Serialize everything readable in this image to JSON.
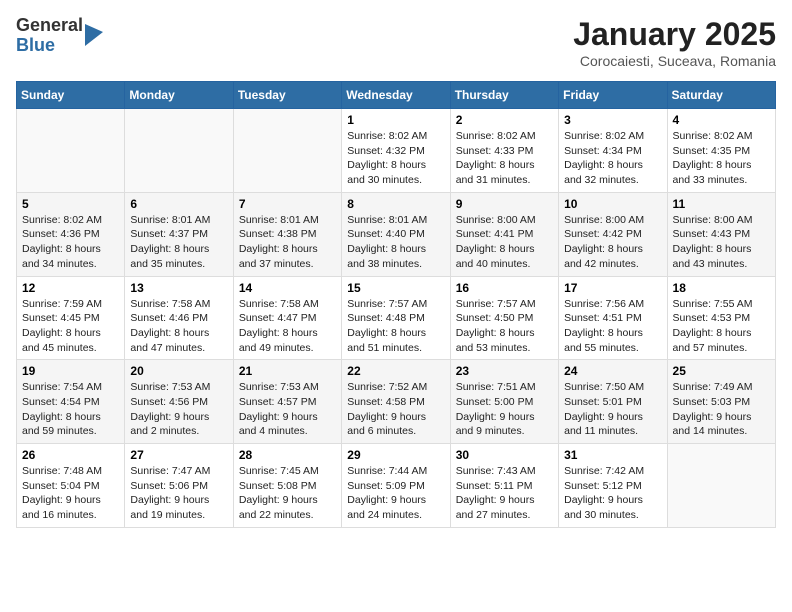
{
  "logo": {
    "line1": "General",
    "line2": "Blue"
  },
  "title": "January 2025",
  "subtitle": "Corocaiesti, Suceava, Romania",
  "days_of_week": [
    "Sunday",
    "Monday",
    "Tuesday",
    "Wednesday",
    "Thursday",
    "Friday",
    "Saturday"
  ],
  "weeks": [
    [
      {
        "day": "",
        "info": ""
      },
      {
        "day": "",
        "info": ""
      },
      {
        "day": "",
        "info": ""
      },
      {
        "day": "1",
        "info": "Sunrise: 8:02 AM\nSunset: 4:32 PM\nDaylight: 8 hours\nand 30 minutes."
      },
      {
        "day": "2",
        "info": "Sunrise: 8:02 AM\nSunset: 4:33 PM\nDaylight: 8 hours\nand 31 minutes."
      },
      {
        "day": "3",
        "info": "Sunrise: 8:02 AM\nSunset: 4:34 PM\nDaylight: 8 hours\nand 32 minutes."
      },
      {
        "day": "4",
        "info": "Sunrise: 8:02 AM\nSunset: 4:35 PM\nDaylight: 8 hours\nand 33 minutes."
      }
    ],
    [
      {
        "day": "5",
        "info": "Sunrise: 8:02 AM\nSunset: 4:36 PM\nDaylight: 8 hours\nand 34 minutes."
      },
      {
        "day": "6",
        "info": "Sunrise: 8:01 AM\nSunset: 4:37 PM\nDaylight: 8 hours\nand 35 minutes."
      },
      {
        "day": "7",
        "info": "Sunrise: 8:01 AM\nSunset: 4:38 PM\nDaylight: 8 hours\nand 37 minutes."
      },
      {
        "day": "8",
        "info": "Sunrise: 8:01 AM\nSunset: 4:40 PM\nDaylight: 8 hours\nand 38 minutes."
      },
      {
        "day": "9",
        "info": "Sunrise: 8:00 AM\nSunset: 4:41 PM\nDaylight: 8 hours\nand 40 minutes."
      },
      {
        "day": "10",
        "info": "Sunrise: 8:00 AM\nSunset: 4:42 PM\nDaylight: 8 hours\nand 42 minutes."
      },
      {
        "day": "11",
        "info": "Sunrise: 8:00 AM\nSunset: 4:43 PM\nDaylight: 8 hours\nand 43 minutes."
      }
    ],
    [
      {
        "day": "12",
        "info": "Sunrise: 7:59 AM\nSunset: 4:45 PM\nDaylight: 8 hours\nand 45 minutes."
      },
      {
        "day": "13",
        "info": "Sunrise: 7:58 AM\nSunset: 4:46 PM\nDaylight: 8 hours\nand 47 minutes."
      },
      {
        "day": "14",
        "info": "Sunrise: 7:58 AM\nSunset: 4:47 PM\nDaylight: 8 hours\nand 49 minutes."
      },
      {
        "day": "15",
        "info": "Sunrise: 7:57 AM\nSunset: 4:48 PM\nDaylight: 8 hours\nand 51 minutes."
      },
      {
        "day": "16",
        "info": "Sunrise: 7:57 AM\nSunset: 4:50 PM\nDaylight: 8 hours\nand 53 minutes."
      },
      {
        "day": "17",
        "info": "Sunrise: 7:56 AM\nSunset: 4:51 PM\nDaylight: 8 hours\nand 55 minutes."
      },
      {
        "day": "18",
        "info": "Sunrise: 7:55 AM\nSunset: 4:53 PM\nDaylight: 8 hours\nand 57 minutes."
      }
    ],
    [
      {
        "day": "19",
        "info": "Sunrise: 7:54 AM\nSunset: 4:54 PM\nDaylight: 8 hours\nand 59 minutes."
      },
      {
        "day": "20",
        "info": "Sunrise: 7:53 AM\nSunset: 4:56 PM\nDaylight: 9 hours\nand 2 minutes."
      },
      {
        "day": "21",
        "info": "Sunrise: 7:53 AM\nSunset: 4:57 PM\nDaylight: 9 hours\nand 4 minutes."
      },
      {
        "day": "22",
        "info": "Sunrise: 7:52 AM\nSunset: 4:58 PM\nDaylight: 9 hours\nand 6 minutes."
      },
      {
        "day": "23",
        "info": "Sunrise: 7:51 AM\nSunset: 5:00 PM\nDaylight: 9 hours\nand 9 minutes."
      },
      {
        "day": "24",
        "info": "Sunrise: 7:50 AM\nSunset: 5:01 PM\nDaylight: 9 hours\nand 11 minutes."
      },
      {
        "day": "25",
        "info": "Sunrise: 7:49 AM\nSunset: 5:03 PM\nDaylight: 9 hours\nand 14 minutes."
      }
    ],
    [
      {
        "day": "26",
        "info": "Sunrise: 7:48 AM\nSunset: 5:04 PM\nDaylight: 9 hours\nand 16 minutes."
      },
      {
        "day": "27",
        "info": "Sunrise: 7:47 AM\nSunset: 5:06 PM\nDaylight: 9 hours\nand 19 minutes."
      },
      {
        "day": "28",
        "info": "Sunrise: 7:45 AM\nSunset: 5:08 PM\nDaylight: 9 hours\nand 22 minutes."
      },
      {
        "day": "29",
        "info": "Sunrise: 7:44 AM\nSunset: 5:09 PM\nDaylight: 9 hours\nand 24 minutes."
      },
      {
        "day": "30",
        "info": "Sunrise: 7:43 AM\nSunset: 5:11 PM\nDaylight: 9 hours\nand 27 minutes."
      },
      {
        "day": "31",
        "info": "Sunrise: 7:42 AM\nSunset: 5:12 PM\nDaylight: 9 hours\nand 30 minutes."
      },
      {
        "day": "",
        "info": ""
      }
    ]
  ]
}
